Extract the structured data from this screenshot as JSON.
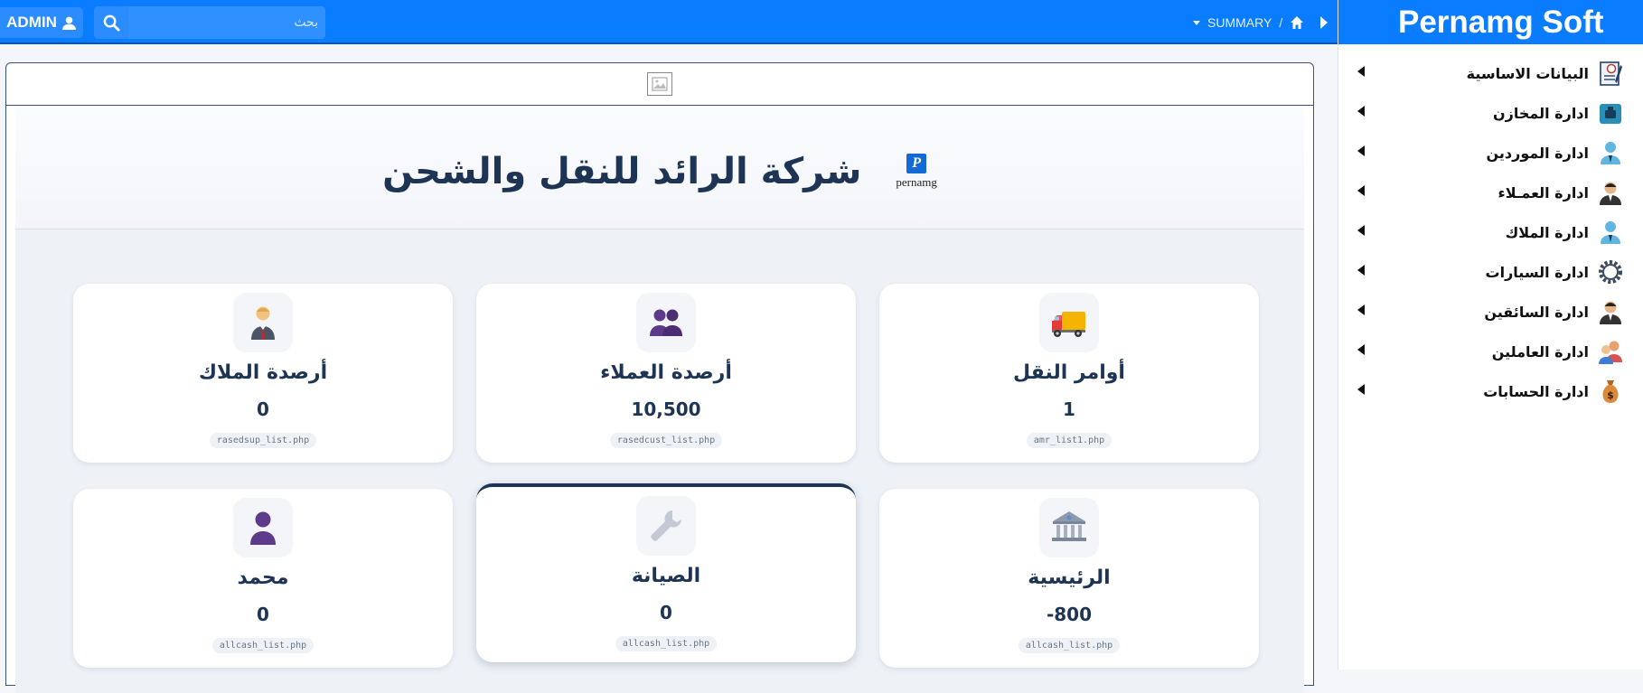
{
  "topbar": {
    "admin_label": "ADMIN",
    "search_placeholder": "بحث",
    "breadcrumb_label": "SUMMARY",
    "breadcrumb_separator": "/"
  },
  "sidebar": {
    "brand": "Pernamg Soft",
    "items": [
      {
        "label": "البيانات الاساسية",
        "icon": "basic-data-icon"
      },
      {
        "label": "ادارة المخازن",
        "icon": "warehouse-icon"
      },
      {
        "label": "ادارة الموردين",
        "icon": "supplier-icon"
      },
      {
        "label": "ادارة العمـلاء",
        "icon": "customer-icon"
      },
      {
        "label": "ادارة الملاك",
        "icon": "owner-icon"
      },
      {
        "label": "ادارة السيارات",
        "icon": "gear-icon"
      },
      {
        "label": "ادارة السائقين",
        "icon": "driver-icon"
      },
      {
        "label": "ادارة العاملين",
        "icon": "workers-icon"
      },
      {
        "label": "ادارة الحسابات",
        "icon": "money-bag-icon"
      }
    ]
  },
  "hero": {
    "title": "شركة الرائد للنقل والشحن",
    "logo_letter": "P",
    "logo_text": "pernamg"
  },
  "cards": [
    {
      "title": "أوامر النقل",
      "value": "1",
      "file": "amr_list1.php",
      "icon": "truck-icon"
    },
    {
      "title": "أرصدة العملاء",
      "value": "10,500",
      "file": "rasedcust_list.php",
      "icon": "customers-icon"
    },
    {
      "title": "أرصدة الملاك",
      "value": "0",
      "file": "rasedsup_list.php",
      "icon": "owner-person-icon"
    },
    {
      "title": "الرئيسية",
      "value": "-800",
      "file": "allcash_list.php",
      "icon": "bank-icon"
    },
    {
      "title": "الصيانة",
      "value": "0",
      "file": "allcash_list.php",
      "icon": "wrench-icon"
    },
    {
      "title": "محمد",
      "value": "0",
      "file": "allcash_list.php",
      "icon": "person-icon"
    }
  ],
  "colors": {
    "topbar": "#0a7cff",
    "navy": "#1e3454",
    "panel_bg": "#eef2f7"
  }
}
